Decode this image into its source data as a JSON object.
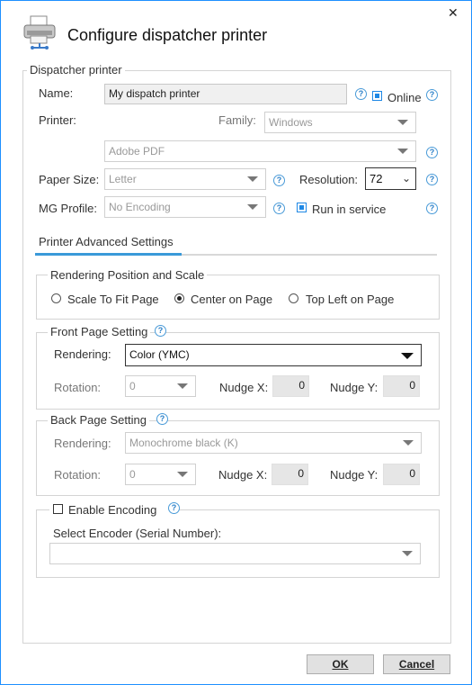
{
  "dialog": {
    "title": "Configure dispatcher printer",
    "close_glyph": "✕",
    "icon": "printer-icon"
  },
  "dispatcher_printer": {
    "legend": "Dispatcher printer",
    "name_label": "Name:",
    "name_value": "My dispatch printer",
    "online_label": "Online",
    "online_checked": true,
    "printer_label": "Printer:",
    "family_label": "Family:",
    "family_value": "Windows",
    "printer_value": "Adobe PDF",
    "paper_size_label": "Paper Size:",
    "paper_size_value": "Letter",
    "resolution_label": "Resolution:",
    "resolution_value": "72",
    "mg_profile_label": "MG Profile:",
    "mg_profile_value": "No Encoding",
    "run_in_service_label": "Run in service",
    "run_in_service_checked": true
  },
  "tabs": {
    "advanced_label": "Printer Advanced Settings"
  },
  "rendering_position": {
    "legend": "Rendering Position and Scale",
    "options": [
      "Scale To Fit Page",
      "Center on Page",
      "Top Left on Page"
    ],
    "selected": "Center on Page"
  },
  "front_page": {
    "legend": "Front Page Setting",
    "rendering_label": "Rendering:",
    "rendering_value": "Color (YMC)",
    "rotation_label": "Rotation:",
    "rotation_value": "0",
    "nudge_x_label": "Nudge X:",
    "nudge_x_value": "0",
    "nudge_y_label": "Nudge Y:",
    "nudge_y_value": "0"
  },
  "back_page": {
    "legend": "Back Page Setting",
    "rendering_label": "Rendering:",
    "rendering_value": "Monochrome black (K)",
    "rotation_label": "Rotation:",
    "rotation_value": "0",
    "nudge_x_label": "Nudge X:",
    "nudge_x_value": "0",
    "nudge_y_label": "Nudge Y:",
    "nudge_y_value": "0"
  },
  "encoding": {
    "enable_label": "Enable Encoding",
    "enable_checked": false,
    "encoder_label": "Select Encoder (Serial Number):",
    "encoder_value": ""
  },
  "buttons": {
    "ok_label": "OK",
    "cancel_label": "Cancel"
  },
  "help_glyph": "?",
  "colors": {
    "accent": "#1e88e5",
    "tab_underline": "#3a9ad9",
    "window_border": "#1e90ff"
  }
}
